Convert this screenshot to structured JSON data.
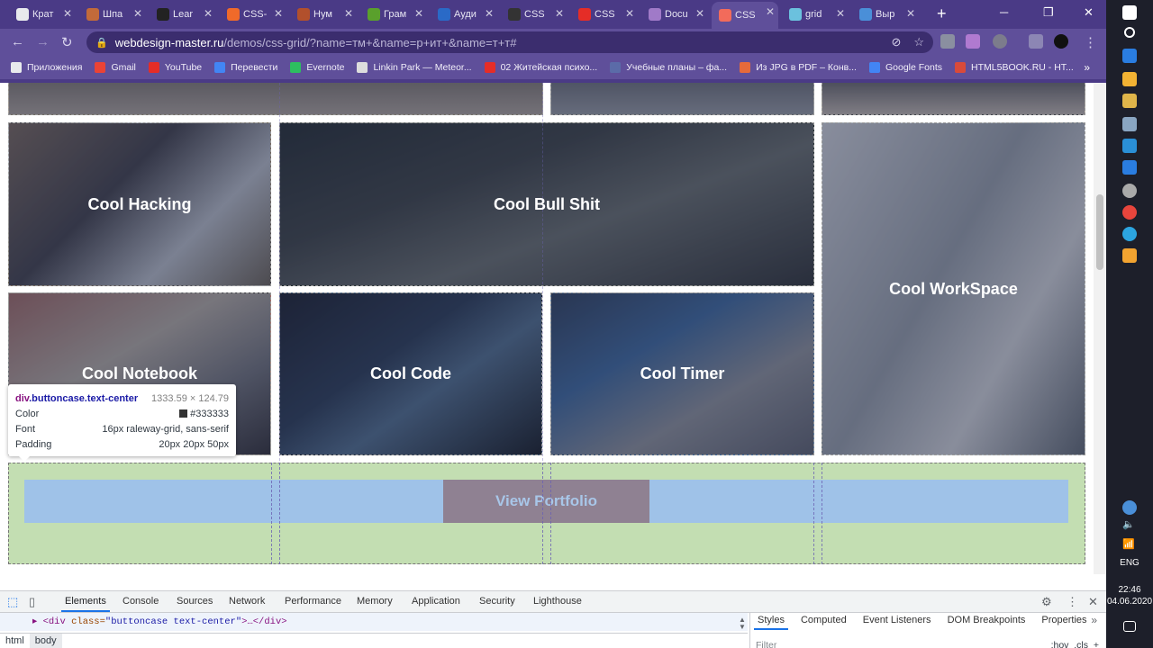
{
  "browser": {
    "tabs": [
      {
        "label": "Крат",
        "color": "#e8eaed"
      },
      {
        "label": "Шпа",
        "color": "#c26a3a"
      },
      {
        "label": "Lear",
        "color": "#222222"
      },
      {
        "label": "CSS-",
        "color": "#f06a2a"
      },
      {
        "label": "Нум",
        "color": "#b2502c"
      },
      {
        "label": "Грам",
        "color": "#5aa02c"
      },
      {
        "label": "Ауди",
        "color": "#2a6ac7"
      },
      {
        "label": "CSS",
        "color": "#333333"
      },
      {
        "label": "CSS",
        "color": "#e52d27"
      },
      {
        "label": "Docu",
        "color": "#a07ac8"
      },
      {
        "label": "CSS",
        "color": "#f26b5b"
      },
      {
        "label": "grid",
        "color": "#6bc1de"
      },
      {
        "label": "Выр",
        "color": "#4a8fd8"
      }
    ],
    "new_tab": "+",
    "window_min": "─",
    "window_max": "❐",
    "window_close": "✕",
    "nav_back": "←",
    "nav_forward": "→",
    "nav_reload": "↻",
    "url_host": "webdesign-master.ru",
    "url_path": "/demos/css-grid/?name=тм+&name=р+ит+&name=т+т#",
    "bookmarks": [
      {
        "label": "Приложения",
        "color": "#e8eaed"
      },
      {
        "label": "Gmail",
        "color": "#ea4335"
      },
      {
        "label": "YouTube",
        "color": "#e52d27"
      },
      {
        "label": "Перевести",
        "color": "#4285f4"
      },
      {
        "label": "Evernote",
        "color": "#2dbe60"
      },
      {
        "label": "Linkin Park — Meteor...",
        "color": "#dddddd"
      },
      {
        "label": "02 Житейская психо...",
        "color": "#e52d27"
      },
      {
        "label": "Учебные планы – фа...",
        "color": "#5b6ba8"
      },
      {
        "label": "Из JPG в PDF – Конв...",
        "color": "#e56a3a"
      },
      {
        "label": "Google Fonts",
        "color": "#4285f4"
      },
      {
        "label": "HTML5BOOK.RU - HT...",
        "color": "#d84a3a"
      }
    ],
    "bookmarks_more": "»"
  },
  "gallery": {
    "items": [
      {
        "title": "Cool Hacking"
      },
      {
        "title": "Cool Bull Shit"
      },
      {
        "title": "Cool WorkSpace"
      },
      {
        "title": "Cool Notebook"
      },
      {
        "title": "Cool Code"
      },
      {
        "title": "Cool Timer"
      }
    ],
    "portfolio_button": "View Portfolio"
  },
  "inspector_tooltip": {
    "selector_tag": "div",
    "selector_class": ".buttoncase.text-center",
    "size": "1333.59 × 124.79",
    "color_label": "Color",
    "color_value": "#333333",
    "font_label": "Font",
    "font_value": "16px raleway-grid, sans-serif",
    "padding_label": "Padding",
    "padding_value": "20px 20px 50px"
  },
  "devtools": {
    "tabs": [
      "Elements",
      "Console",
      "Sources",
      "Network",
      "Performance",
      "Memory",
      "Application",
      "Security",
      "Lighthouse"
    ],
    "active_tab": "Elements",
    "element_code_open": "<div ",
    "element_code_attr": "class=",
    "element_code_val": "\"buttoncase text-center\"",
    "element_code_close": ">…</div>",
    "breadcrumbs": [
      "html",
      "body"
    ],
    "styles_tabs": [
      "Styles",
      "Computed",
      "Event Listeners",
      "DOM Breakpoints",
      "Properties"
    ],
    "styles_more": "»",
    "filter_placeholder": "Filter",
    "filter_hov": ":hov",
    "filter_cls": ".cls",
    "filter_add": "+"
  },
  "taskbar": {
    "language": "ENG",
    "time": "22:46",
    "date": "04.06.2020"
  }
}
